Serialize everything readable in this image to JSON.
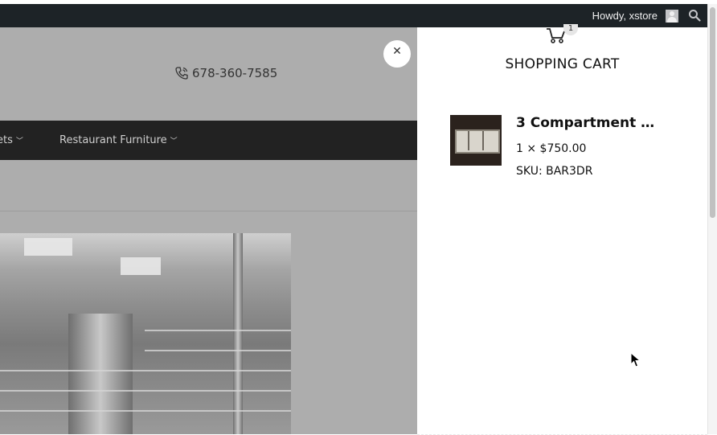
{
  "admin_bar": {
    "greeting": "Howdy, xstore",
    "search_icon": "search-icon",
    "avatar_icon": "user-avatar-icon"
  },
  "header": {
    "phone": "678-360-7585",
    "phone_icon": "phone-icon"
  },
  "nav": {
    "items": [
      {
        "label": "ets"
      },
      {
        "label": "Restaurant Furniture"
      }
    ]
  },
  "cart": {
    "title": "SHOPPING CART",
    "count": "1",
    "close_icon": "close-icon",
    "items": [
      {
        "name": "3 Compartment Ba...",
        "quantity_price": "1 × $750.00",
        "sku": "SKU: BAR3DR"
      }
    ]
  },
  "colors": {
    "admin_bar": "#1d2327",
    "nav_bar": "#222222",
    "overlay": "#adadad",
    "drawer": "#ffffff"
  }
}
